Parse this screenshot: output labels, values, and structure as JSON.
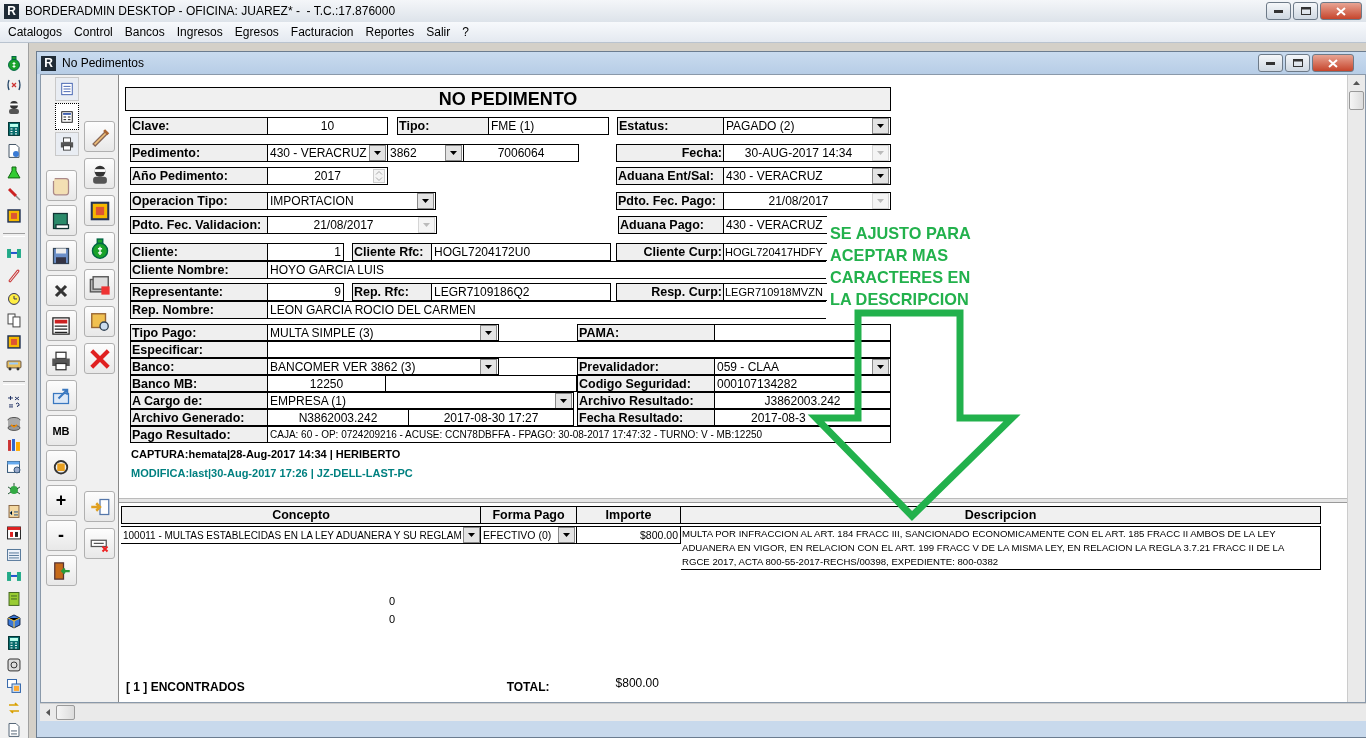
{
  "window": {
    "logo": "R",
    "title": "BORDERADMIN DESKTOP - OFICINA: JUAREZ* -  - T.C.:17.876000"
  },
  "menu": [
    "Catalogos",
    "Control",
    "Bancos",
    "Ingresos",
    "Egresos",
    "Facturacion",
    "Reportes",
    "Salir",
    "?"
  ],
  "child_window": {
    "logo": "R",
    "title": "No Pedimentos"
  },
  "view_tabs": [
    {
      "selected": false
    },
    {
      "selected": true
    },
    {
      "selected": false
    }
  ],
  "text_buttons": [
    "MB",
    "+",
    "-"
  ],
  "form": {
    "title": "NO PEDIMENTO",
    "clave": {
      "label": "Clave:",
      "value": "10"
    },
    "tipo": {
      "label": "Tipo:",
      "value": "FME (1)"
    },
    "estatus": {
      "label": "Estatus:",
      "value": "PAGADO (2)",
      "disabled": false
    },
    "pedimento": {
      "label": "Pedimento:",
      "values": [
        "430 - VERACRUZ",
        "3862",
        "7006064"
      ]
    },
    "fecha": {
      "label": "Fecha:",
      "value": "30-AUG-2017 14:34",
      "disabled": true
    },
    "anio": {
      "label": "Año Pedimento:",
      "value": "2017"
    },
    "aduana_ent_sal": {
      "label": "Aduana Ent/Sal:",
      "value": "430 - VERACRUZ",
      "disabled": false
    },
    "operacion_tipo": {
      "label": "Operacion Tipo:",
      "value": "IMPORTACION",
      "disabled": false
    },
    "fec_pago": {
      "label": "Pdto. Fec. Pago:",
      "value": "21/08/2017",
      "disabled": true
    },
    "fec_validacion": {
      "label": "Pdto. Fec. Validacion:",
      "value": "21/08/2017",
      "disabled": true
    },
    "aduana_pago": {
      "label": "Aduana Pago:",
      "value": "430 - VERACRUZ"
    },
    "cliente": {
      "label": "Cliente:",
      "value": "1"
    },
    "cliente_rfc": {
      "label": "Cliente Rfc:",
      "value": "HOGL7204172U0"
    },
    "cliente_curp": {
      "label": "Cliente Curp:",
      "value": "HOGL720417HDFY"
    },
    "cliente_nombre": {
      "label": "Cliente Nombre:",
      "value": "HOYO GARCIA LUIS"
    },
    "representante": {
      "label": "Representante:",
      "value": "9"
    },
    "rep_rfc": {
      "label": "Rep. Rfc:",
      "value": "LEGR7109186Q2"
    },
    "resp_curp": {
      "label": "Resp. Curp:",
      "value": "LEGR710918MVZN"
    },
    "rep_nombre": {
      "label": "Rep. Nombre:",
      "value": "LEON GARCIA ROCIO DEL CARMEN"
    },
    "tipo_pago": {
      "label": "Tipo Pago:",
      "value": "MULTA SIMPLE (3)",
      "disabled": false
    },
    "pama": {
      "label": "PAMA:"
    },
    "especificar": {
      "label": "Especificar:"
    },
    "banco": {
      "label": "Banco:",
      "value": "BANCOMER VER 3862 (3)",
      "disabled": false
    },
    "prevalidador": {
      "label": "Prevalidador:",
      "value": "059 - CLAA",
      "disabled": false
    },
    "banco_mb": {
      "label": "Banco MB:",
      "value": "12250"
    },
    "codigo_seguridad": {
      "label": "Codigo Seguridad:",
      "value": "000107134282"
    },
    "a_cargo": {
      "label": "A Cargo de:",
      "value": "EMPRESA (1)",
      "disabled": false
    },
    "archivo_resultado": {
      "label": "Archivo Resultado:",
      "value": "J3862003.242"
    },
    "archivo_generado": {
      "label": "Archivo Generado:",
      "values": [
        "N3862003.242",
        "2017-08-30 17:27"
      ]
    },
    "fecha_resultado": {
      "label": "Fecha Resultado:",
      "value": "2017-08-3"
    },
    "pago_resultado": {
      "label": "Pago Resultado:",
      "value": "CAJA: 60 - OP: 0724209216 - ACUSE: CCN78DBFFA - FPAGO: 30-08-2017 17:47:32 - TURNO: V - MB:12250"
    }
  },
  "audit_lines": [
    {
      "text": "CAPTURA:hemata|28-Aug-2017 14:34 | HERIBERTO",
      "color": "#000000"
    },
    {
      "text": "MODIFICA:last|30-Aug-2017 17:26 | JZ-DELL-LAST-PC",
      "color": "#008080"
    }
  ],
  "grid": {
    "columns": [
      "Concepto",
      "Forma Pago",
      "Importe",
      "Descripcion"
    ],
    "rows": [
      {
        "concepto": "100011 - MULTAS ESTABLECIDAS EN LA LEY ADUANERA Y SU REGLAM",
        "forma_pago": "EFECTIVO (0)",
        "importe": "$800.00",
        "descripcion": [
          "MULTA POR INFRACCION AL ART. 184 FRACC III, SANCIONADO ECONOMICAMENTE CON EL ART. 185 FRACC II AMBOS DE LA LEY",
          "ADUANERA EN VIGOR, EN RELACION CON EL ART. 199 FRACC V DE LA MISMA LEY, EN RELACION LA REGLA 3.7.21 FRACC II DE LA",
          "RGCE 2017, ACTA 800-55-2017-RECHS/00398, EXPEDIENTE: 800-0382"
        ]
      }
    ]
  },
  "summary_values": [
    "0",
    "0"
  ],
  "footer": {
    "found": "[ 1 ] ENCONTRADOS",
    "total_label": "TOTAL:",
    "total": "$800.00"
  },
  "annotation": {
    "lines": [
      "SE AJUSTO PARA",
      "ACEPTAR MAS",
      "CARACTERES EN",
      "LA DESCRIPCION"
    ]
  }
}
